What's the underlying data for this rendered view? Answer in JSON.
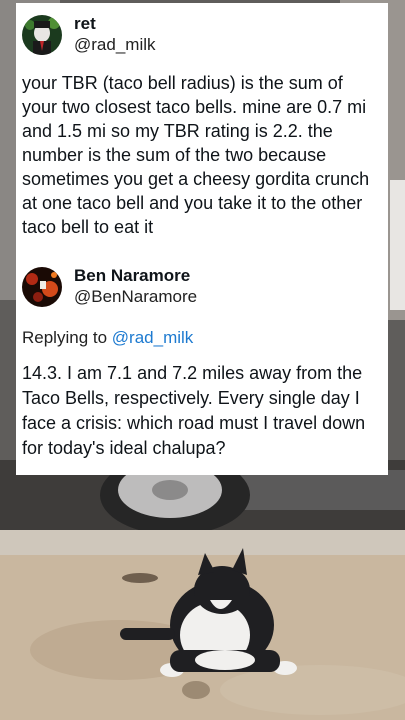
{
  "original_tweet": {
    "display_name": "ret",
    "handle": "@rad_milk",
    "text": "your TBR (taco bell radius) is the sum of your two closest taco bells. mine are 0.7 mi and 1.5 mi so my TBR rating is 2.2. the number is the sum of the two because sometimes you get a cheesy gordita crunch at one taco bell and you take it to the other taco bell to eat it"
  },
  "reply_tweet": {
    "display_name": "Ben Naramore",
    "handle": "@BenNaramore",
    "replying_prefix": "Replying to",
    "replying_to": "@rad_milk",
    "text": "14.3. I am 7.1 and 7.2 miles away from the Taco Bells, respectively. Every single day I face a crisis: which road must I travel down for today's ideal chalupa?"
  },
  "colors": {
    "card_background": "#ffffff",
    "mention_blue": "#1d7ad0",
    "text_dark": "#0f1419"
  }
}
